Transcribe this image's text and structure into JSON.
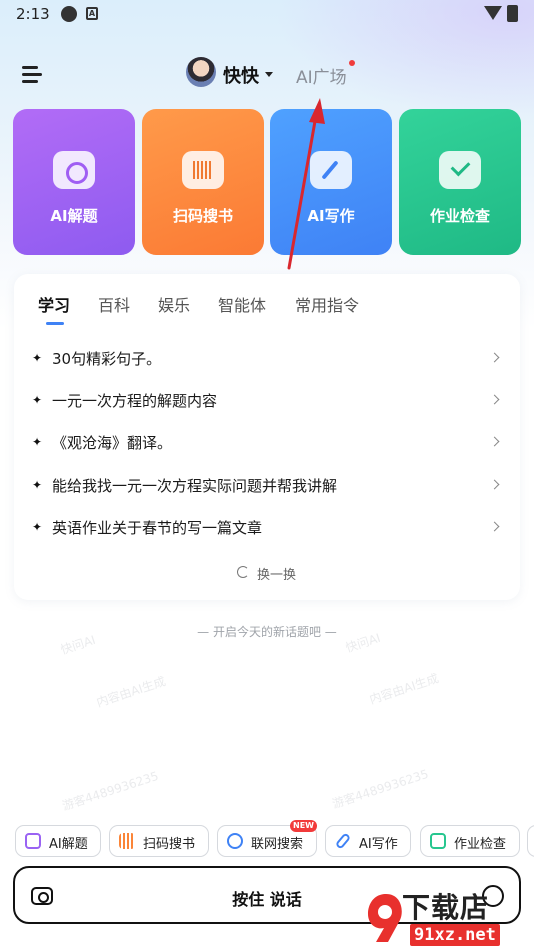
{
  "status_bar": {
    "time": "2:13"
  },
  "header": {
    "title": "快快",
    "ai_tab": "AI广场"
  },
  "feature_cards": [
    {
      "label": "AI解题",
      "icon": "camera-icon",
      "color": "#9a63f3"
    },
    {
      "label": "扫码搜书",
      "icon": "barcode-icon",
      "color": "#fb8538"
    },
    {
      "label": "AI写作",
      "icon": "pen-icon",
      "color": "#4590fa"
    },
    {
      "label": "作业检查",
      "icon": "check-folder-icon",
      "color": "#27c68f"
    }
  ],
  "tabs": [
    "学习",
    "百科",
    "娱乐",
    "智能体",
    "常用指令"
  ],
  "active_tab": "学习",
  "prompts": [
    "30句精彩句子。",
    "一元一次方程的解题内容",
    "《观沧海》翻译。",
    "能给我找一元一次方程实际问题并帮我讲解",
    "英语作业关于春节的写一篇文章"
  ],
  "refresh_label": "换一换",
  "new_topic_hint": "— 开启今天的新话题吧 —",
  "watermarks": [
    "快问AI",
    "内容由AI生成",
    "游客4489936235",
    "快问AI",
    "内容由AI生成",
    "游客4489936235"
  ],
  "bottom_chips": [
    {
      "label": "AI解题",
      "icon": "camera-icon"
    },
    {
      "label": "扫码搜书",
      "icon": "barcode-icon"
    },
    {
      "label": "联网搜索",
      "icon": "globe-icon",
      "badge": "NEW"
    },
    {
      "label": "AI写作",
      "icon": "pen-icon"
    },
    {
      "label": "作业检查",
      "icon": "check-folder-icon"
    }
  ],
  "input_bar": {
    "hold_label": "按住 说话"
  },
  "site_logo": {
    "text": "下载店",
    "url": "91xz.net"
  },
  "colors": {
    "accent": "#3f82f5",
    "annotation_arrow": "#d9272e",
    "dot": "#f03c3c"
  }
}
